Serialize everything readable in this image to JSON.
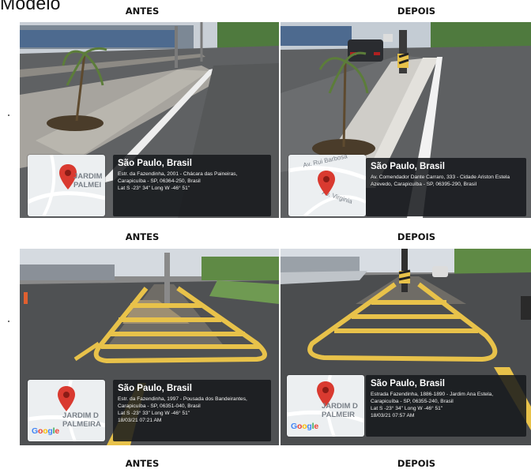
{
  "document": {
    "title": "Modelo"
  },
  "captions": {
    "row1_before": "ANTES",
    "row1_after": "DEPOIS",
    "row2_before": "ANTES",
    "row2_after": "DEPOIS",
    "row3_before": "ANTES",
    "row3_after": "DEPOIS"
  },
  "photos": [
    {
      "map_label_line1": "JARDIM",
      "map_label_line2": "PALMEI",
      "city": "São Paulo, Brasil",
      "address": "Estr. da Fazendinha, 2001 - Chácara das Paineiras, Carapicuíba - SP, 06364-250, Brasil",
      "coords": "Lat S -23° 34'' Long W -46° 51''",
      "date": ""
    },
    {
      "map_label_line1": "Av. Rui Barbosa",
      "map_label_line2": "Av. Virginia",
      "city": "São Paulo, Brasil",
      "address": "Av. Comendador Dante Carraro, 333 - Cidade Ariston Estela Azevedo, Carapicuíba - SP, 06395-290, Brasil",
      "coords": "",
      "date": ""
    },
    {
      "map_label_line1": "JARDIM D",
      "map_label_line2": "PALMEIRA",
      "google": "Google",
      "city": "São Paulo, Brasil",
      "address": "Estr. da Fazendinha, 1997 - Pousada dos Bandeirantes, Carapicuíba - SP, 06351-040, Brasil",
      "coords": "Lat S -23° 33'' Long W -46° 51''",
      "date": "18/03/21 07:21 AM"
    },
    {
      "map_label_line1": "JARDIM D",
      "map_label_line2": "PALMEIR",
      "google": "Google",
      "city": "São Paulo, Brasil",
      "address": "Estrada Fazendinha, 1886-1890 - Jardim Ana Estela, Carapicuíba - SP, 06355-240, Brasil",
      "coords": "Lat S -23° 34'' Long W -46° 51''",
      "date": "18/03/21 07:57 AM"
    }
  ],
  "colors": {
    "road_marking_yellow": "#e8c24a",
    "map_pin": "#d93a30",
    "info_overlay": "#16181c"
  }
}
